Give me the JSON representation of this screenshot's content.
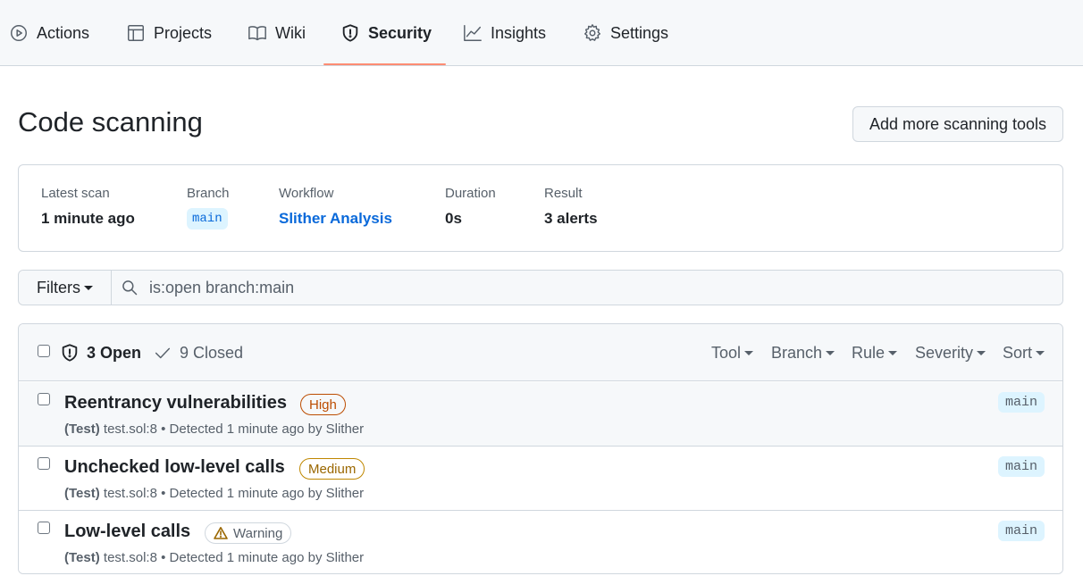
{
  "nav": {
    "tabs": [
      {
        "label": "Actions",
        "icon": "play-icon"
      },
      {
        "label": "Projects",
        "icon": "table-icon"
      },
      {
        "label": "Wiki",
        "icon": "book-icon"
      },
      {
        "label": "Security",
        "icon": "shield-icon",
        "active": true
      },
      {
        "label": "Insights",
        "icon": "graph-icon"
      },
      {
        "label": "Settings",
        "icon": "gear-icon"
      }
    ],
    "active_underline_color": "#fd8c73"
  },
  "page": {
    "title": "Code scanning",
    "add_tools_label": "Add more scanning tools"
  },
  "scan": {
    "latest_label": "Latest scan",
    "latest_value": "1 minute ago",
    "branch_label": "Branch",
    "branch_value": "main",
    "workflow_label": "Workflow",
    "workflow_value": "Slither Analysis",
    "duration_label": "Duration",
    "duration_value": "0s",
    "result_label": "Result",
    "result_value": "3 alerts"
  },
  "filters": {
    "button_label": "Filters",
    "query": "is:open branch:main"
  },
  "alerts": {
    "open_label": "3 Open",
    "closed_label": "9 Closed",
    "header_filters": [
      "Tool",
      "Branch",
      "Rule",
      "Severity",
      "Sort"
    ],
    "rows": [
      {
        "title": "Reentrancy vulnerabilities",
        "severity": "High",
        "meta_prefix": "(Test)",
        "meta_rest": " test.sol:8 • Detected 1 minute ago by Slither",
        "branch": "main"
      },
      {
        "title": "Unchecked low-level calls",
        "severity": "Medium",
        "meta_prefix": "(Test)",
        "meta_rest": " test.sol:8 • Detected 1 minute ago by Slither",
        "branch": "main"
      },
      {
        "title": "Low-level calls",
        "severity": "Warning",
        "meta_prefix": "(Test)",
        "meta_rest": " test.sol:8 • Detected 1 minute ago by Slither",
        "branch": "main"
      }
    ]
  },
  "colors": {
    "link": "#0969da",
    "high": "#bc4c00",
    "medium": "#9a6700",
    "border": "#d0d7de",
    "subtle_bg": "#f6f8fa"
  }
}
